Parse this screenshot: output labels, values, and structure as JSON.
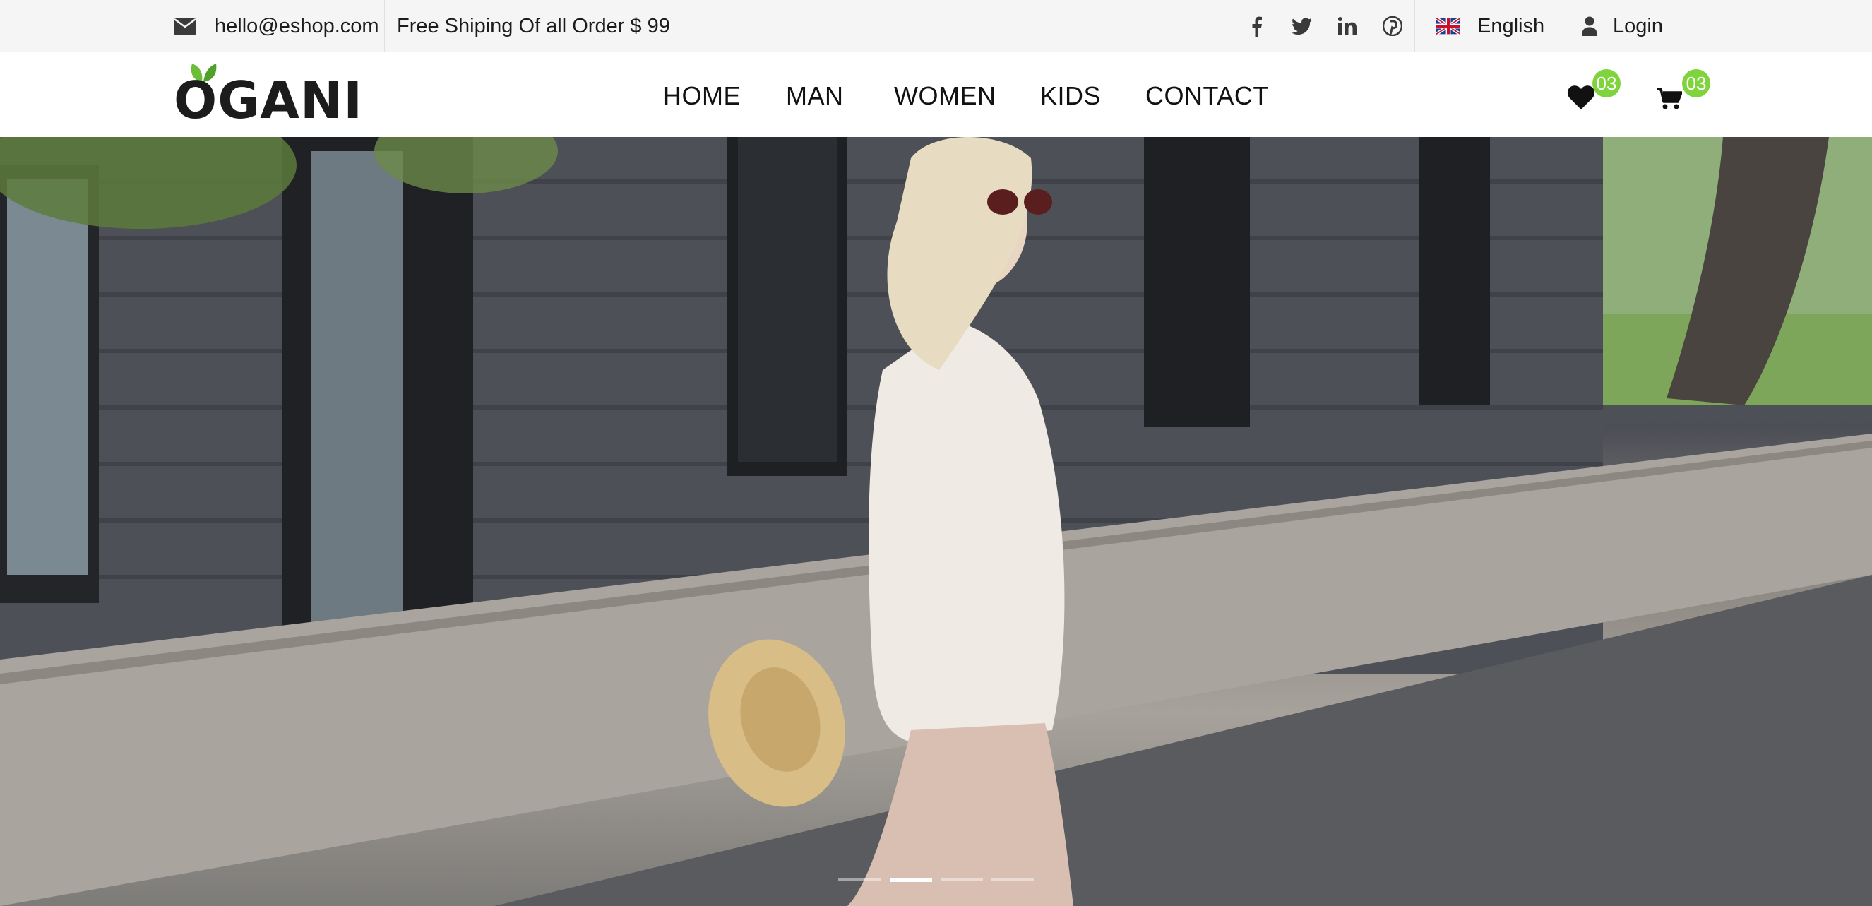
{
  "topbar": {
    "email": "hello@eshop.com",
    "shipping": "Free Shiping Of all Order $ 99",
    "social_icons": [
      "facebook-icon",
      "twitter-icon",
      "linkedin-icon",
      "pinterest-icon"
    ],
    "language": "English",
    "login": "Login"
  },
  "header": {
    "logo": "OGANI",
    "nav": [
      {
        "label": "HOME"
      },
      {
        "label": "MAN"
      },
      {
        "label": "WOMEN"
      },
      {
        "label": "KIDS"
      },
      {
        "label": "CONTACT"
      }
    ],
    "wishlist_count": "03",
    "cart_count": "03"
  },
  "hero": {
    "slide_count": 4,
    "active_slide": 2
  },
  "colors": {
    "accent": "#7fd33c",
    "topbar_bg": "#f5f5f5",
    "text": "#1c1c1c"
  }
}
